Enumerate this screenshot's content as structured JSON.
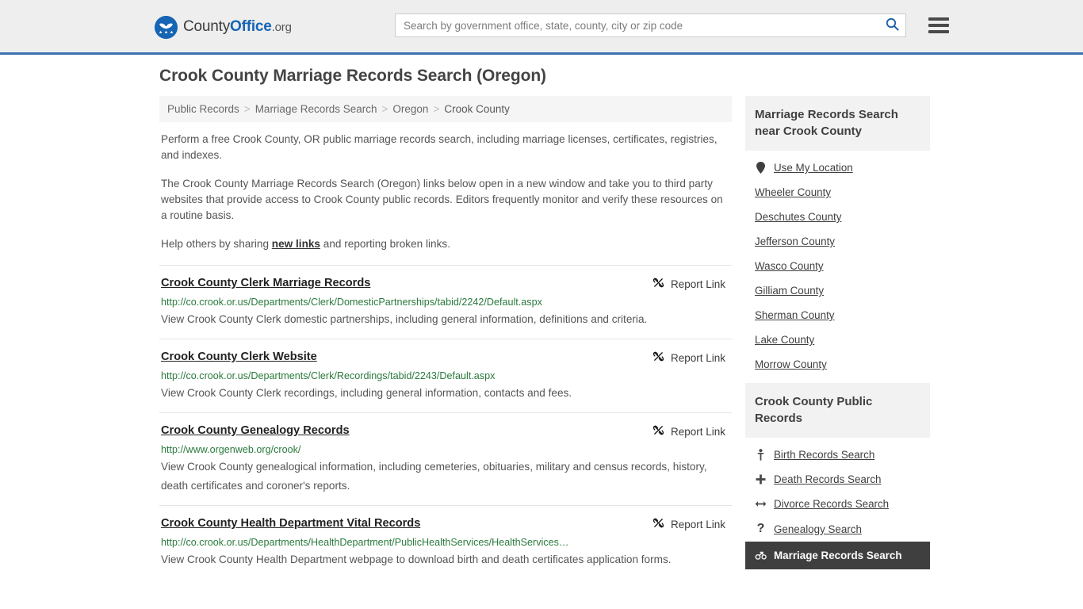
{
  "header": {
    "logo": {
      "icon": "eagle-shield-icon",
      "text_county": "County",
      "text_office": "Office",
      "text_org": ".org"
    },
    "search": {
      "placeholder": "Search by government office, state, county, city or zip code",
      "value": "",
      "icon": "search-icon"
    },
    "menu_icon": "hamburger-menu-icon"
  },
  "page": {
    "title": "Crook County Marriage Records Search (Oregon)"
  },
  "breadcrumb": {
    "separator": ">",
    "items": [
      {
        "label": "Public Records"
      },
      {
        "label": "Marriage Records Search"
      },
      {
        "label": "Oregon"
      },
      {
        "label": "Crook County"
      }
    ]
  },
  "intro": {
    "p1": "Perform a free Crook County, OR public marriage records search, including marriage licenses, certificates, registries, and indexes.",
    "p2": "The Crook County Marriage Records Search (Oregon) links below open in a new window and take you to third party websites that provide access to Crook County public records. Editors frequently monitor and verify these resources on a routine basis.",
    "p3_before": "Help others by sharing ",
    "p3_link": "new links",
    "p3_after": " and reporting broken links."
  },
  "results": {
    "report_label": "Report Link",
    "report_icon": "broken-link-icon",
    "items": [
      {
        "title": "Crook County Clerk Marriage Records",
        "url": "http://co.crook.or.us/Departments/Clerk/DomesticPartnerships/tabid/2242/Default.aspx",
        "description": "View Crook County Clerk domestic partnerships, including general information, definitions and criteria."
      },
      {
        "title": "Crook County Clerk Website",
        "url": "http://co.crook.or.us/Departments/Clerk/Recordings/tabid/2243/Default.aspx",
        "description": "View Crook County Clerk recordings, including general information, contacts and fees."
      },
      {
        "title": "Crook County Genealogy Records",
        "url": "http://www.orgenweb.org/crook/",
        "description": "View Crook County genealogical information, including cemeteries, obituaries, military and census records, history, death certificates and coroner's reports."
      },
      {
        "title": "Crook County Health Department Vital Records",
        "url": "http://co.crook.or.us/Departments/HealthDepartment/PublicHealthServices/HealthServices…",
        "description": "View Crook County Health Department webpage to download birth and death certificates application forms."
      }
    ]
  },
  "sidebar": {
    "nearby": {
      "heading": "Marriage Records Search near Crook County",
      "items": [
        {
          "label": "Use My Location",
          "icon": "map-pin-icon",
          "glyph": "•"
        },
        {
          "label": "Wheeler County",
          "icon": "",
          "glyph": ""
        },
        {
          "label": "Deschutes County",
          "icon": "",
          "glyph": ""
        },
        {
          "label": "Jefferson County",
          "icon": "",
          "glyph": ""
        },
        {
          "label": "Wasco County",
          "icon": "",
          "glyph": ""
        },
        {
          "label": "Gilliam County",
          "icon": "",
          "glyph": ""
        },
        {
          "label": "Sherman County",
          "icon": "",
          "glyph": ""
        },
        {
          "label": "Lake County",
          "icon": "",
          "glyph": ""
        },
        {
          "label": "Morrow County",
          "icon": "",
          "glyph": ""
        }
      ]
    },
    "public_records": {
      "heading": "Crook County Public Records",
      "items": [
        {
          "label": "Birth Records Search",
          "icon": "baby-icon",
          "glyph": "👶",
          "active": false
        },
        {
          "label": "Death Records Search",
          "icon": "cross-icon",
          "glyph": "✚",
          "active": false
        },
        {
          "label": "Divorce Records Search",
          "icon": "left-right-arrow-icon",
          "glyph": "↔",
          "active": false
        },
        {
          "label": "Genealogy Search",
          "icon": "question-mark-icon",
          "glyph": "?",
          "active": false
        },
        {
          "label": "Marriage Records Search",
          "icon": "male-female-icon",
          "glyph": "⚤",
          "active": true
        }
      ]
    }
  },
  "colors": {
    "brand_blue": "#1665b5",
    "header_rule": "#3b73ad",
    "url_green": "#2a7a3d",
    "panel_head_bg": "#f2f2f2",
    "active_bg": "#3f3f3f"
  }
}
